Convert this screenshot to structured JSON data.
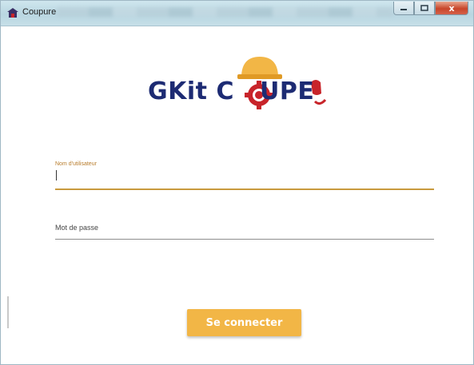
{
  "window": {
    "title": "Coupure",
    "icon": "house-icon",
    "controls": [
      "minimize-icon",
      "maximize-icon",
      "close-icon"
    ],
    "close_glyph": "x"
  },
  "logo": {
    "text_left": "GKit C",
    "text_right": "UP",
    "text_last": "E",
    "accent_colors": {
      "blue": "#1d2b73",
      "red": "#c8242a",
      "yellow": "#f2b646"
    }
  },
  "form": {
    "username": {
      "label": "Nom d'utilisateur",
      "value": "",
      "placeholder": ""
    },
    "password": {
      "label": "Mot de passe",
      "value": ""
    },
    "submit_label": "Se connecter"
  },
  "colors": {
    "accent": "#f2b646",
    "underline_active": "#c89a3e",
    "underline_idle": "#8e8e8e"
  }
}
